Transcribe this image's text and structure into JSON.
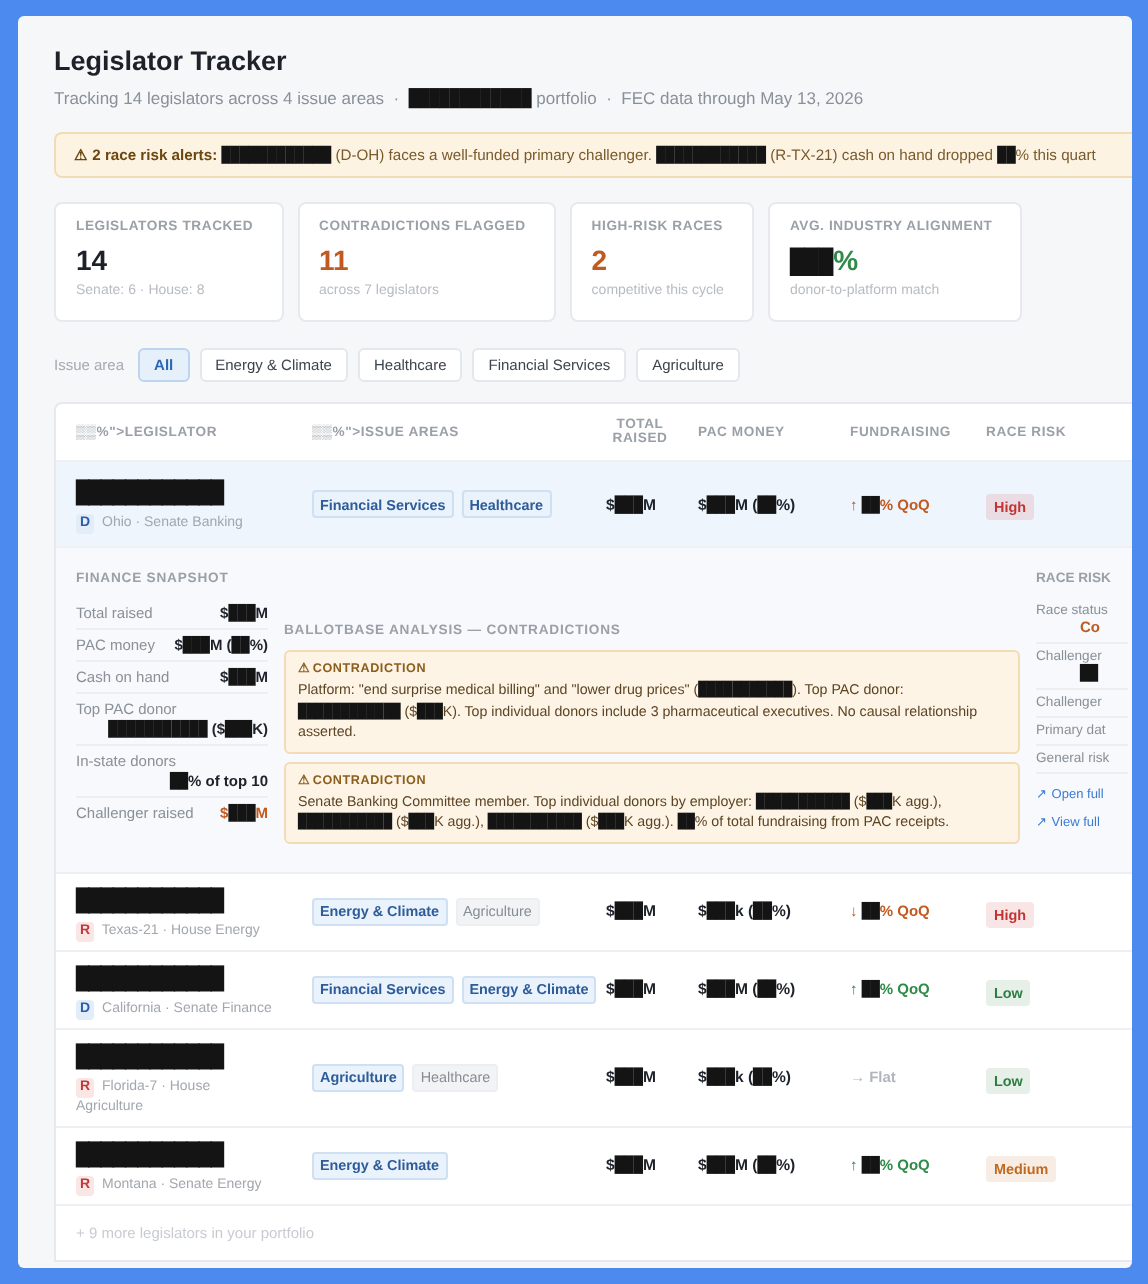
{
  "header": {
    "title": "Legislator Tracker",
    "subtitle": "Tracking 14 legislators across 4 issue areas  ·  ████████████ portfolio  ·  FEC data through May 13, 2026"
  },
  "alert": {
    "label": "⚠ 2 race risk alerts:",
    "text": "████████████ (D-OH) faces a well-funded primary challenger. ████████████ (R-TX-21) cash on hand dropped ██% this quart"
  },
  "stats": [
    {
      "label": "LEGISLATORS TRACKED",
      "value": "14",
      "note": "Senate: 6  ·  House: 8",
      "color": "#1d2129"
    },
    {
      "label": "CONTRADICTIONS FLAGGED",
      "value": "11",
      "note": "across 7 legislators",
      "color": "#c05a20"
    },
    {
      "label": "HIGH-RISK RACES",
      "value": "2",
      "note": "competitive this cycle",
      "color": "#c05a20"
    },
    {
      "label": "AVG. INDUSTRY ALIGNMENT",
      "value": "███%",
      "note": "donor-to-platform match",
      "color": "#2e8a47"
    }
  ],
  "filters": {
    "label": "Issue area",
    "chips": [
      {
        "label": "All",
        "selected": true
      },
      {
        "label": "Energy & Climate",
        "selected": false
      },
      {
        "label": "Healthcare",
        "selected": false
      },
      {
        "label": "Financial Services",
        "selected": false
      },
      {
        "label": "Agriculture",
        "selected": false
      }
    ]
  },
  "table": {
    "columns": [
      "▒▒%\">LEGISLATOR",
      "▒▒%\">ISSUE AREAS",
      "TOTAL RAISED",
      "PAC MONEY",
      "FUNDRAISING",
      "RACE RISK"
    ],
    "rows": [
      {
        "name": "████████████",
        "party": {
          "label": "D",
          "kind": "dem"
        },
        "district": "Ohio  ·  Senate Banking",
        "tags": [
          {
            "label": "Financial Services",
            "kind": "primary"
          },
          {
            "label": "Healthcare",
            "kind": "primary"
          }
        ],
        "total": "$███M",
        "pac": "$███M (██%)",
        "trend": {
          "text": "↑ ██% QoQ",
          "color": "#c05a20"
        },
        "risk": {
          "label": "High",
          "color": "#c23434"
        },
        "selected": true,
        "expanded": true
      },
      {
        "name": "████████████",
        "party": {
          "label": "R",
          "kind": "rep"
        },
        "district": "Texas-21  ·  House Energy",
        "tags": [
          {
            "label": "Energy & Climate",
            "kind": "primary"
          },
          {
            "label": "Agriculture",
            "kind": "secondary"
          }
        ],
        "total": "$███M",
        "pac": "$███k (██%)",
        "trend": {
          "text": "↓ ██% QoQ",
          "color": "#c05a20"
        },
        "risk": {
          "label": "High",
          "color": "#c23434"
        },
        "selected": false,
        "expanded": false
      },
      {
        "name": "████████████",
        "party": {
          "label": "D",
          "kind": "dem"
        },
        "district": "California  ·  Senate Finance",
        "tags": [
          {
            "label": "Financial Services",
            "kind": "primary"
          },
          {
            "label": "Energy & Climate",
            "kind": "primary"
          }
        ],
        "total": "$███M",
        "pac": "$███M (██%)",
        "trend": {
          "text": "↑ ██% QoQ",
          "color": "#2e8a47"
        },
        "risk": {
          "label": "Low",
          "color": "#2e7d42"
        },
        "selected": false,
        "expanded": false
      },
      {
        "name": "████████████",
        "party": {
          "label": "R",
          "kind": "rep"
        },
        "district": "Florida-7  ·  House Agriculture",
        "tags": [
          {
            "label": "Agriculture",
            "kind": "primary"
          },
          {
            "label": "Healthcare",
            "kind": "secondary"
          }
        ],
        "total": "$███M",
        "pac": "$███k (██%)",
        "trend": {
          "text": "→ Flat",
          "color": "#b2b6bc"
        },
        "risk": {
          "label": "Low",
          "color": "#2e7d42"
        },
        "selected": false,
        "expanded": false
      },
      {
        "name": "████████████",
        "party": {
          "label": "R",
          "kind": "rep"
        },
        "district": "Montana  ·  Senate Energy",
        "tags": [
          {
            "label": "Energy & Climate",
            "kind": "primary"
          }
        ],
        "total": "$███M",
        "pac": "$███M (██%)",
        "trend": {
          "text": "↑ ██% QoQ",
          "color": "#2e8a47"
        },
        "risk": {
          "label": "Medium",
          "color": "#c06a20"
        },
        "selected": false,
        "expanded": false
      }
    ],
    "footer": "+ 9 more legislators in your portfolio"
  },
  "detail": {
    "finance": {
      "title": "FINANCE SNAPSHOT",
      "items": [
        {
          "label": "Total raised",
          "value": "$███M",
          "color": "#1d2129"
        },
        {
          "label": "PAC money",
          "value": "$███M (██%)",
          "color": "#1d2129"
        },
        {
          "label": "Cash on hand",
          "value": "$███M",
          "color": "#1d2129"
        },
        {
          "label": "Top PAC donor",
          "value": "███████████ ($███K)",
          "color": "#1d2129"
        },
        {
          "label": "In-state donors",
          "value": "██% of top 10",
          "color": "#1d2129"
        },
        {
          "label": "Challenger raised",
          "value": "$███M",
          "color": "#c05a20"
        }
      ]
    },
    "analysis": {
      "title": "BALLOTBASE ANALYSIS — CONTRADICTIONS",
      "items": [
        {
          "heading": "⚠ CONTRADICTION",
          "text": "Platform: \"end surprise medical billing\" and \"lower drug prices\" (███████████). Top PAC donor: ████████████ ($███K). Top individual donors include 3 pharmaceutical executives. No causal relationship asserted."
        },
        {
          "heading": "⚠ CONTRADICTION",
          "text": "Senate Banking Committee member. Top individual donors by employer: ███████████ ($███K agg.), ███████████ ($███K agg.), ███████████ ($███K agg.). ██% of total fundraising from PAC receipts."
        }
      ]
    },
    "risk": {
      "title": "RACE RISK",
      "items": [
        {
          "label": "Race status",
          "value": "Co"
        },
        {
          "label": "Challenger",
          "value": "██"
        },
        {
          "label": "Challenger"
        },
        {
          "label": "Primary dat"
        },
        {
          "label": "General risk"
        }
      ],
      "links": [
        "↗ Open full",
        "↗ View full"
      ]
    }
  }
}
